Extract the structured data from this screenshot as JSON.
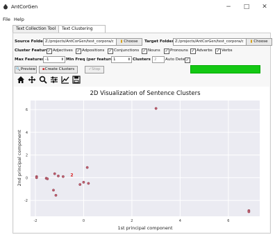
{
  "window": {
    "title": "AntCorGen",
    "minimize": "−",
    "maximize": "□",
    "close": "✕"
  },
  "menu": {
    "items": [
      "File",
      "Help"
    ]
  },
  "tabs": [
    {
      "label": "Text Collection Tool"
    },
    {
      "label": "Text Clustering Tool"
    }
  ],
  "folders": {
    "source_label": "Source Folder",
    "source_value": "Z:/projects/AntCorGen/test_corpora/c",
    "choose_label": "Choose",
    "target_label": "Target Folder",
    "target_value": "Z:/projects/AntCorGen/test_corpora/c",
    "choose2_label": "Choose"
  },
  "features": {
    "label": "Cluster Features",
    "options": [
      {
        "label": "Adjectives",
        "checked": true
      },
      {
        "label": "Adpositions",
        "checked": true
      },
      {
        "label": "Conjunctions",
        "checked": true
      },
      {
        "label": "Nouns",
        "checked": true
      },
      {
        "label": "Pronouns",
        "checked": true
      },
      {
        "label": "Adverbs",
        "checked": true
      },
      {
        "label": "Verbs",
        "checked": true
      }
    ]
  },
  "params": {
    "max_features_label": "Max Features",
    "max_features_value": "-1",
    "min_freq_label": "Min Freq (per feature)",
    "min_freq_value": "1",
    "clusters_label": "Clusters",
    "clusters_value": "2",
    "auto_detect_label": "Auto Detect"
  },
  "actions": {
    "preview": "Preview",
    "create": "Create Clusters",
    "stop": "Stop"
  },
  "toolbar_icons": [
    "home-icon",
    "pan-icon",
    "zoom-icon",
    "configure-icon",
    "edit-axis-icon",
    "save-icon"
  ],
  "chart_data": {
    "type": "scatter",
    "title": "2D Visualization of Sentence Clusters",
    "xlabel": "1st principal component",
    "ylabel": "2nd principal component",
    "xlim": [
      -2.2,
      7.3
    ],
    "ylim": [
      -3.4,
      6.8
    ],
    "xticks": [
      -2,
      0,
      2,
      4,
      6
    ],
    "xtick_labels": [
      "-2",
      "0",
      "2",
      "4",
      "6"
    ],
    "yticks": [
      -2,
      0,
      2,
      4,
      6
    ],
    "yticks_labels": [
      "-2",
      "0",
      "2",
      "4",
      "6"
    ],
    "grid": true,
    "point_color": "#c06070",
    "annotation": {
      "text": "2",
      "x": -0.55,
      "y": 0.12,
      "color": "#d8191a"
    },
    "points": [
      {
        "x": -1.95,
        "y": 0.1
      },
      {
        "x": -1.95,
        "y": 0.0
      },
      {
        "x": -1.55,
        "y": -0.05
      },
      {
        "x": -1.5,
        "y": -0.1
      },
      {
        "x": -1.2,
        "y": 0.35
      },
      {
        "x": -1.05,
        "y": 0.15
      },
      {
        "x": -0.85,
        "y": 0.1
      },
      {
        "x": -1.25,
        "y": -1.1
      },
      {
        "x": -1.15,
        "y": -1.55
      },
      {
        "x": -0.15,
        "y": -0.6
      },
      {
        "x": 0.0,
        "y": -0.4
      },
      {
        "x": 0.2,
        "y": -0.5
      },
      {
        "x": 0.15,
        "y": 0.9
      },
      {
        "x": 3.0,
        "y": 6.1
      },
      {
        "x": 6.85,
        "y": -2.9
      },
      {
        "x": 6.85,
        "y": -3.0
      }
    ]
  }
}
